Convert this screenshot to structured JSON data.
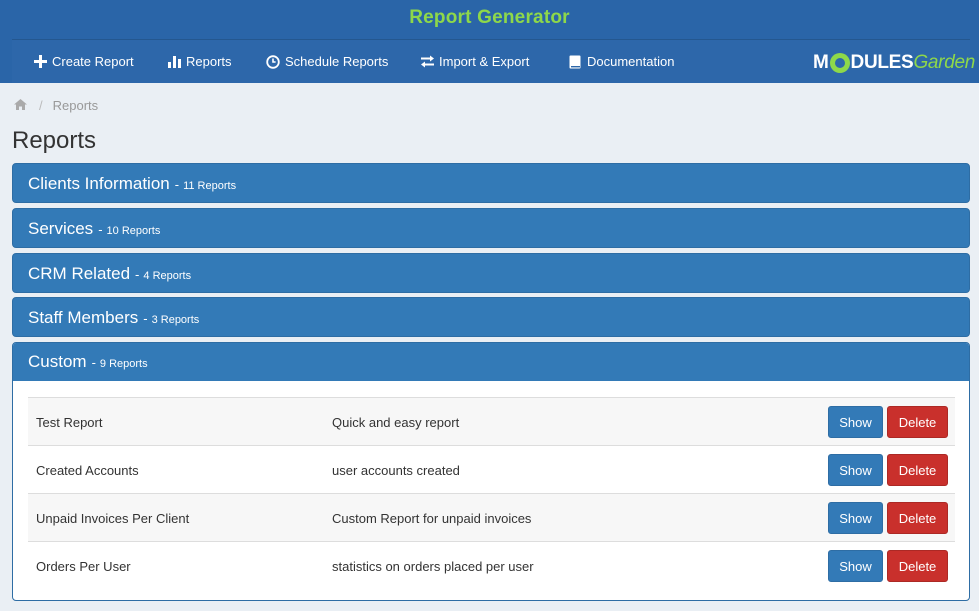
{
  "app": {
    "title": "Report Generator"
  },
  "nav": {
    "items": [
      {
        "label": "Create Report",
        "icon": "plus-icon"
      },
      {
        "label": "Reports",
        "icon": "bar-chart-icon"
      },
      {
        "label": "Schedule Reports",
        "icon": "clock-icon"
      },
      {
        "label": "Import & Export",
        "icon": "exchange-icon"
      },
      {
        "label": "Documentation",
        "icon": "book-icon"
      }
    ]
  },
  "logo": {
    "part1": "M",
    "part2": "DULES",
    "part3": "Garden"
  },
  "breadcrumb": {
    "home_icon": "home-icon",
    "current": "Reports",
    "separator": "/"
  },
  "page": {
    "title": "Reports"
  },
  "categories": [
    {
      "name": "Clients Information",
      "count": "11 Reports",
      "dash": "-"
    },
    {
      "name": "Services",
      "count": "10 Reports",
      "dash": "-"
    },
    {
      "name": "CRM Related",
      "count": "4 Reports",
      "dash": "-"
    },
    {
      "name": "Staff Members",
      "count": "3 Reports",
      "dash": "-"
    },
    {
      "name": "Custom",
      "count": "9 Reports",
      "dash": "-"
    }
  ],
  "custom_reports": {
    "show_label": "Show",
    "delete_label": "Delete",
    "rows": [
      {
        "name": "Test Report",
        "description": "Quick and easy report"
      },
      {
        "name": "Created Accounts",
        "description": "user accounts created"
      },
      {
        "name": "Unpaid Invoices Per Client",
        "description": "Custom Report for unpaid invoices"
      },
      {
        "name": "Orders Per User",
        "description": "statistics on orders placed per user"
      }
    ]
  },
  "colors": {
    "header_bg": "#2a65a8",
    "title_green": "#8ed84a",
    "panel_blue": "#337ab7",
    "delete_red": "#c9302c"
  }
}
